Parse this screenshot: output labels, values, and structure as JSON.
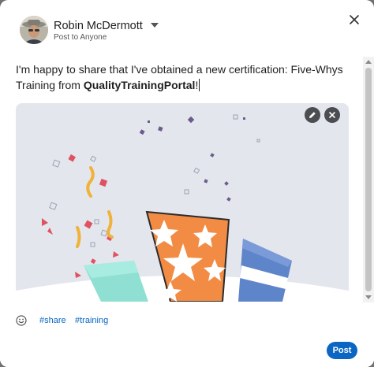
{
  "composer": {
    "author_name": "Robin McDermott",
    "audience": "Post to Anyone",
    "post_text_before": "I'm happy to share that I've obtained a new certification: Five-Whys Training from ",
    "post_text_bold": "QualityTrainingPortal",
    "post_text_after": "!",
    "hashtags": [
      "#share",
      "#training"
    ],
    "post_label": "Post"
  },
  "icons": {
    "caret": "caret-down-icon",
    "close": "close-icon",
    "edit": "pencil-icon",
    "remove": "remove-image-icon",
    "emoji": "emoji-icon"
  },
  "colors": {
    "accent": "#0a66c2",
    "image_background": "#e3e6ed",
    "orange": "#f28c44",
    "blue": "#5e84c9",
    "teal": "#8fe0d2",
    "red_confetti": "#e05260",
    "gold_confetti": "#f0b23a",
    "purple_confetti": "#6b5a8a"
  }
}
